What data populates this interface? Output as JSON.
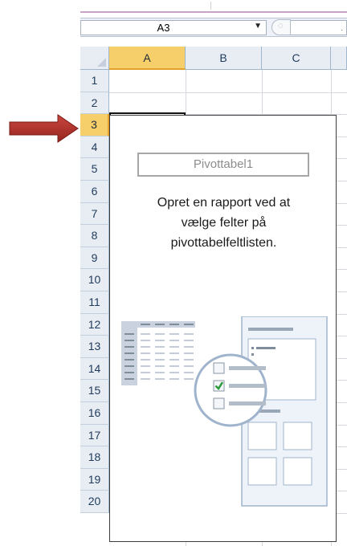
{
  "name_box": {
    "value": "A3"
  },
  "columns": [
    {
      "label": "A",
      "selected": true
    },
    {
      "label": "B",
      "selected": false
    },
    {
      "label": "C",
      "selected": false
    }
  ],
  "rows": [
    {
      "label": "1",
      "selected": false
    },
    {
      "label": "2",
      "selected": false
    },
    {
      "label": "3",
      "selected": true
    },
    {
      "label": "4",
      "selected": false
    },
    {
      "label": "5",
      "selected": false
    },
    {
      "label": "6",
      "selected": false
    },
    {
      "label": "7",
      "selected": false
    },
    {
      "label": "8",
      "selected": false
    },
    {
      "label": "9",
      "selected": false
    },
    {
      "label": "10",
      "selected": false
    },
    {
      "label": "11",
      "selected": false
    },
    {
      "label": "12",
      "selected": false
    },
    {
      "label": "13",
      "selected": false
    },
    {
      "label": "14",
      "selected": false
    },
    {
      "label": "15",
      "selected": false
    },
    {
      "label": "16",
      "selected": false
    },
    {
      "label": "17",
      "selected": false
    },
    {
      "label": "18",
      "selected": false
    },
    {
      "label": "19",
      "selected": false
    },
    {
      "label": "20",
      "selected": false
    }
  ],
  "pivot": {
    "name": "Pivottabel1",
    "message_lines": [
      "Opret en rapport ved at",
      "vælge felter på",
      "pivottabelfeltlisten."
    ]
  },
  "colors": {
    "selected_header": "#f7cf6a",
    "header_bg": "#e8edf4",
    "arrow_red": "#b8322d",
    "checkbox_green": "#2e9b3a"
  },
  "icons": {
    "dropdown": "chevron-down-icon",
    "formula_fx": "fx-icon",
    "select_all": "select-all-corner-icon",
    "annotation_arrow": "red-arrow-icon",
    "pivot_illustration": "pivot-field-list-illustration"
  }
}
